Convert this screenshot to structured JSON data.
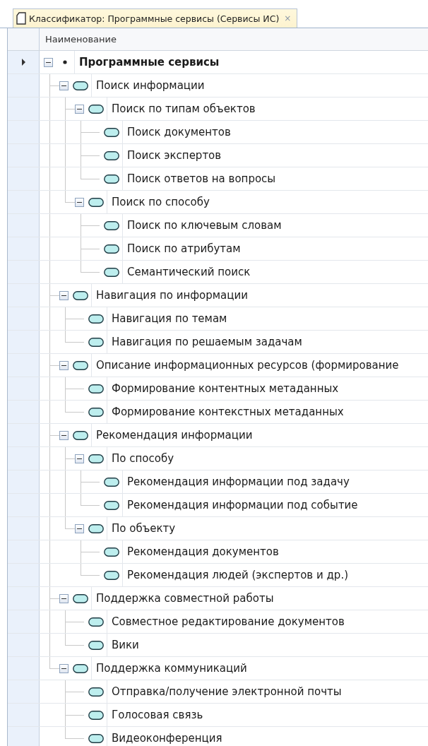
{
  "tab": {
    "title": "Классификатор: Программные сервисы (Сервисы ИС)",
    "close": "×",
    "selected": true
  },
  "grid": {
    "columns": [
      "Наименование"
    ],
    "rows": [
      {
        "name": "Программные сервисы",
        "kind": "root",
        "current": true,
        "expanded": true,
        "children": [
          {
            "name": "Поиск информации",
            "kind": "service",
            "current": false,
            "expanded": true,
            "children": [
              {
                "name": "Поиск по типам объектов",
                "kind": "service",
                "current": false,
                "expanded": true,
                "children": [
                  {
                    "name": "Поиск документов",
                    "kind": "service",
                    "current": false
                  },
                  {
                    "name": "Поиск экспертов",
                    "kind": "service",
                    "current": false
                  },
                  {
                    "name": "Поиск ответов на вопросы",
                    "kind": "service",
                    "current": false
                  }
                ]
              },
              {
                "name": "Поиск по способу",
                "kind": "service",
                "current": false,
                "expanded": true,
                "children": [
                  {
                    "name": "Поиск по ключевым словам",
                    "kind": "service",
                    "current": false
                  },
                  {
                    "name": "Поиск по атрибутам",
                    "kind": "service",
                    "current": false
                  },
                  {
                    "name": "Семантический поиск",
                    "kind": "service",
                    "current": false
                  }
                ]
              }
            ]
          },
          {
            "name": "Навигация по информации",
            "kind": "service",
            "current": false,
            "expanded": true,
            "children": [
              {
                "name": "Навигация по темам",
                "kind": "service",
                "current": false
              },
              {
                "name": "Навигация по решаемым задачам",
                "kind": "service",
                "current": false
              }
            ]
          },
          {
            "name": "Описание информационных ресурсов (формирование",
            "kind": "service",
            "current": false,
            "expanded": true,
            "children": [
              {
                "name": "Формирование контентных метаданных",
                "kind": "service",
                "current": false
              },
              {
                "name": "Формирование контекстных метаданных",
                "kind": "service",
                "current": false
              }
            ]
          },
          {
            "name": "Рекомендация информации",
            "kind": "service",
            "current": false,
            "expanded": true,
            "children": [
              {
                "name": "По способу",
                "kind": "service",
                "current": false,
                "expanded": true,
                "children": [
                  {
                    "name": "Рекомендация информации под задачу",
                    "kind": "service",
                    "current": false
                  },
                  {
                    "name": "Рекомендация информации под событие",
                    "kind": "service",
                    "current": false
                  }
                ]
              },
              {
                "name": "По объекту",
                "kind": "service",
                "current": false,
                "expanded": true,
                "children": [
                  {
                    "name": "Рекомендация документов",
                    "kind": "service",
                    "current": false
                  },
                  {
                    "name": "Рекомендация людей (экспертов и др.)",
                    "kind": "service",
                    "current": false
                  }
                ]
              }
            ]
          },
          {
            "name": "Поддержка совместной работы",
            "kind": "service",
            "current": false,
            "expanded": true,
            "children": [
              {
                "name": "Совместное редактирование документов",
                "kind": "service",
                "current": false
              },
              {
                "name": "Вики",
                "kind": "service",
                "current": false
              }
            ]
          },
          {
            "name": "Поддержка коммуникаций",
            "kind": "service",
            "current": false,
            "expanded": true,
            "children": [
              {
                "name": "Отправка/получение электронной почты",
                "kind": "service",
                "current": false
              },
              {
                "name": "Голосовая связь",
                "kind": "service",
                "current": false
              },
              {
                "name": "Видеоконференция",
                "kind": "service",
                "current": false
              }
            ]
          }
        ]
      }
    ]
  }
}
